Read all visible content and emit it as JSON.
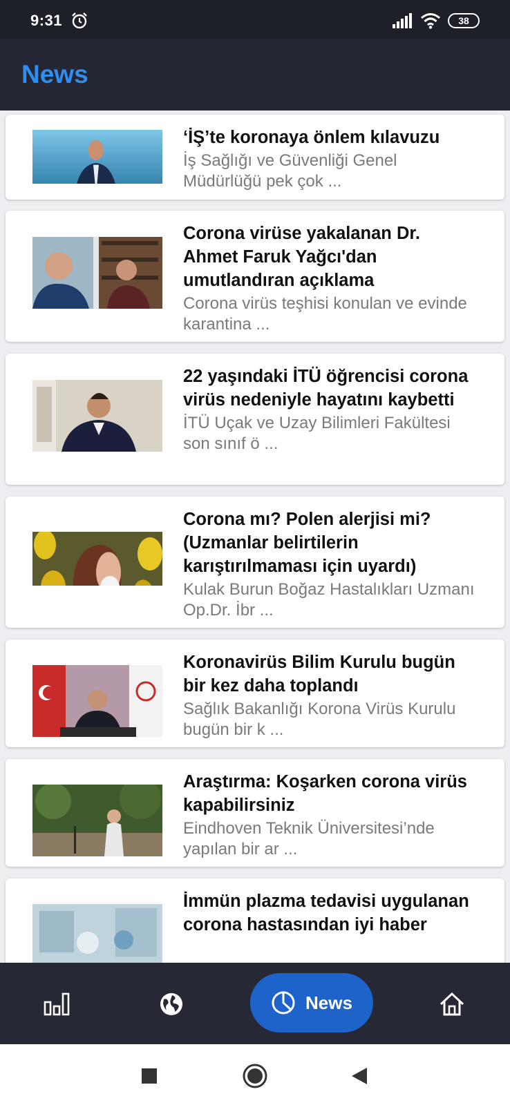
{
  "status_bar": {
    "time": "9:31",
    "battery": "38",
    "icons": [
      "alarm-icon",
      "signal-icon",
      "wifi-icon",
      "battery-icon"
    ]
  },
  "app_bar": {
    "title": "News"
  },
  "articles": [
    {
      "headline": "‘İŞ’te koronaya önlem kılavuzu",
      "summary": "İş Sağlığı ve Güvenliği Genel Müdürlüğü pek çok  ..."
    },
    {
      "headline": "Corona virüse yakalanan Dr. Ahmet Faruk Yağcı'dan umutlandıran açıklama",
      "summary": "Corona virüs teşhisi konulan ve evinde karantina ..."
    },
    {
      "headline": "22 yaşındaki İTÜ öğrencisi corona virüs nedeniyle hayatını kaybetti",
      "summary": "İTÜ Uçak ve Uzay Bilimleri Fakültesi son sınıf ö ..."
    },
    {
      "headline": "Corona mı? Polen alerjisi mi? (Uzmanlar belirtilerin karıştırılmaması için uyardı)",
      "summary": "Kulak Burun Boğaz Hastalıkları Uzmanı Op.Dr. İbr ..."
    },
    {
      "headline": "Koronavirüs Bilim Kurulu bugün bir kez daha toplandı",
      "summary": "Sağlık Bakanlığı Korona Virüs Kurulu bugün bir k ..."
    },
    {
      "headline": "Araştırma: Koşarken corona virüs kapabilirsiniz",
      "summary": "Eindhoven Teknik Üniversitesi’nde yapılan bir ar ..."
    },
    {
      "headline": "İmmün plazma tedavisi uygulanan corona hastasından iyi haber",
      "summary": ""
    }
  ],
  "bottom_nav": {
    "items": [
      {
        "icon": "bar-chart-icon"
      },
      {
        "icon": "globe-icon"
      },
      {
        "icon": "pie-chart-icon",
        "label": "News",
        "active": true
      },
      {
        "icon": "home-icon"
      }
    ]
  },
  "system_nav": {
    "icons": [
      "recents-icon",
      "home-circle-icon",
      "back-icon"
    ]
  },
  "colors": {
    "status_bar": "#1d1f29",
    "app_bar": "#242733",
    "title_accent": "#2f8ef0",
    "bottom_nav": "#262935",
    "active_pill": "#1e63c9",
    "summary_text": "#7a7a7a"
  }
}
